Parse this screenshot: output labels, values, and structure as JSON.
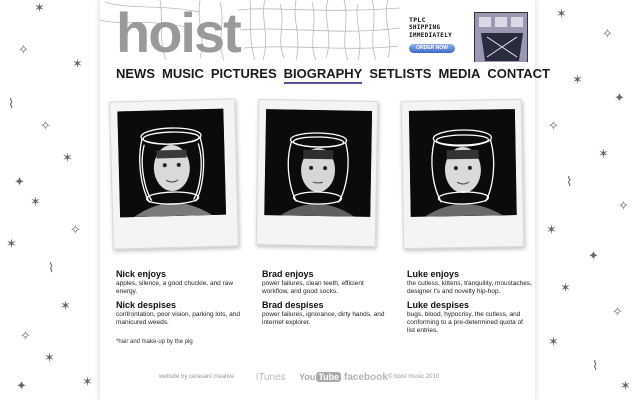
{
  "brand": {
    "logo": "hoist"
  },
  "promo": {
    "line1": "TPLC",
    "line2": "SHIPPING",
    "line3": "IMMEDIATELY",
    "button": "ORDER NOW"
  },
  "nav": {
    "items": [
      {
        "label": "NEWS",
        "active": false
      },
      {
        "label": "MUSIC",
        "active": false
      },
      {
        "label": "PICTURES",
        "active": false
      },
      {
        "label": "BIOGRAPHY",
        "active": true
      },
      {
        "label": "SETLISTS",
        "active": false
      },
      {
        "label": "MEDIA",
        "active": false
      },
      {
        "label": "CONTACT",
        "active": false
      }
    ],
    "active_color": "#5b4da8"
  },
  "members": [
    {
      "enjoys_title": "Nick enjoys",
      "enjoys_text": "apples, silence, a good chuckle, and raw energy.",
      "despises_title": "Nick despises",
      "despises_text": "confrontation, poor vision, parking lots, and manicured weeds."
    },
    {
      "enjoys_title": "Brad enjoys",
      "enjoys_text": "power failures, clean teeth, efficient workflow, and good socks.",
      "despises_title": "Brad despises",
      "despises_text": "power failures, ignorance, dirty hands, and internet explorer."
    },
    {
      "enjoys_title": "Luke enjoys",
      "enjoys_text": "the cutless, kittens, tranquility, moustaches, designer t's and novelty hip-hop.",
      "despises_title": "Luke despises",
      "despises_text": "bugs, blood, hypocrisy, the cutless, and conforming to a pre-determined quota of list entries."
    }
  ],
  "footnote": "*hair and make-up by the pig",
  "footer": {
    "credit": "website by cerasani creative",
    "itunes": "iTunes",
    "youtube_you": "You",
    "youtube_tube": "Tube",
    "facebook": "facebook",
    "copyright": "© hoist music 2010"
  },
  "icons": {
    "background": "star-doodle-icon",
    "halo": "scribble-halo-icon"
  }
}
